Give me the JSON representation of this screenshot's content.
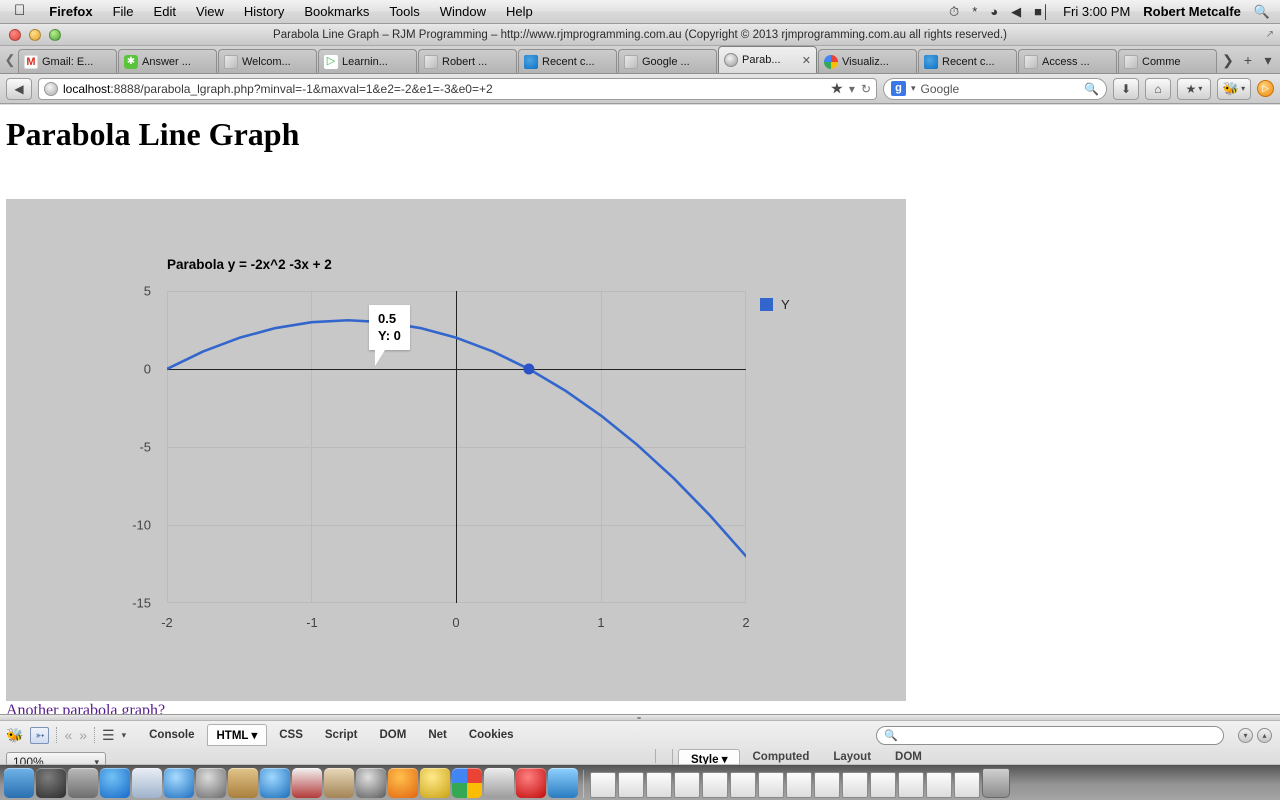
{
  "menubar": {
    "apple_icon": "apple-logo",
    "items": [
      "Firefox",
      "File",
      "Edit",
      "View",
      "History",
      "Bookmarks",
      "Tools",
      "Window",
      "Help"
    ],
    "status_icons": [
      "time-machine-icon",
      "bluetooth-icon",
      "wifi-icon",
      "volume-icon",
      "battery-icon"
    ],
    "clock": "Fri 3:00 PM",
    "user": "Robert Metcalfe",
    "search_icon": "spotlight-search-icon"
  },
  "window": {
    "title": "Parabola Line Graph – RJM Programming – http://www.rjmprogramming.com.au (Copyright © 2013 rjmprogramming.com.au all rights reserved.)"
  },
  "tabs": [
    {
      "label": "Gmail: E...",
      "favicon": "gmail-icon",
      "active": false
    },
    {
      "label": "Answer ...",
      "favicon": "green-chat-icon",
      "active": false
    },
    {
      "label": "Welcom...",
      "favicon": "generic-page-icon",
      "active": false
    },
    {
      "label": "Learnin...",
      "favicon": "play-store-icon",
      "active": false
    },
    {
      "label": "Robert ...",
      "favicon": "generic-page-icon",
      "active": false
    },
    {
      "label": "Recent c...",
      "favicon": "drupal-icon",
      "active": false
    },
    {
      "label": "Google ...",
      "favicon": "generic-page-icon",
      "active": false
    },
    {
      "label": "Parab...",
      "favicon": "globe-icon",
      "active": true,
      "close_label": "✕"
    },
    {
      "label": "Visualiz...",
      "favicon": "google-colors-icon",
      "active": false
    },
    {
      "label": "Recent c...",
      "favicon": "drupal-icon",
      "active": false
    },
    {
      "label": "Access ...",
      "favicon": "generic-page-icon",
      "active": false
    },
    {
      "label": "Comme",
      "favicon": "generic-page-icon",
      "active": false
    }
  ],
  "tabstrip": {
    "scroll_left_icon": "chevron-left-icon",
    "scroll_right_icon": "chevron-right-icon",
    "new_tab_label": "+",
    "tab_list_icon": "chevron-down-icon"
  },
  "navbar": {
    "back_icon": "back-arrow-icon",
    "url_host": "localhost",
    "url_path": ":8888/parabola_lgraph.php?minval=-1&maxval=1&e2=-2&e1=-3&e0=+2",
    "bookmark_icon": "star-icon",
    "bookmark_dropdown_icon": "chevron-down-icon",
    "reload_icon": "reload-icon",
    "search_engine": "Google",
    "search_engine_badge": "g",
    "search_icon": "magnifier-icon",
    "download_icon": "download-arrow-icon",
    "home_icon": "home-icon",
    "bookmarks_icon": "bookmarks-star-icon",
    "firebug_icon": "firebug-bee-icon",
    "addon_icon": "orange-addon-icon"
  },
  "page": {
    "heading": "Parabola Line Graph",
    "link_text": "Another parabola graph?"
  },
  "chart_data": {
    "type": "line",
    "title": "Parabola y = -2x^2 -3x + 2",
    "xlabel": "",
    "ylabel": "",
    "xlim": [
      -2,
      2
    ],
    "ylim": [
      -15,
      5
    ],
    "xticks": [
      "-2",
      "-1",
      "0",
      "1",
      "2"
    ],
    "xtick_values": [
      -2,
      -1,
      0,
      1,
      2
    ],
    "yticks": [
      "5",
      "0",
      "-5",
      "-10",
      "-15"
    ],
    "ytick_values": [
      5,
      0,
      -5,
      -10,
      -15
    ],
    "grid": true,
    "legend": [
      "Y"
    ],
    "legend_position": "right",
    "series": [
      {
        "name": "Y",
        "color": "#3366cc",
        "equation": "y = -2x^2 - 3x + 2",
        "x": [
          -2,
          -1.75,
          -1.5,
          -1.25,
          -1,
          -0.75,
          -0.5,
          -0.25,
          0,
          0.25,
          0.5,
          0.75,
          1,
          1.25,
          1.5,
          1.75,
          2
        ],
        "y": [
          0,
          1.125,
          2,
          2.625,
          3,
          3.125,
          3,
          2.625,
          2,
          1.125,
          0,
          -1.375,
          -3,
          -4.875,
          -7,
          -9.375,
          -12
        ]
      }
    ],
    "tooltip": {
      "x_label": "0.5",
      "y_label": "Y: 0",
      "point_x": 0.5,
      "point_y": 0
    }
  },
  "firebug": {
    "bee_icon": "firebug-bee-icon",
    "inspect_icon": "inspect-cursor-icon",
    "nav_back_icon": "double-chevron-left-icon",
    "nav_forward_icon": "double-chevron-right-icon",
    "menu_icon": "hamburger-menu-icon",
    "options_icon": "chevron-down-icon",
    "tabs": [
      "Console",
      "HTML",
      "CSS",
      "Script",
      "DOM",
      "Net",
      "Cookies"
    ],
    "active_tab": "HTML",
    "active_tab_dropdown": "▾",
    "search_icon": "magnifier-icon",
    "search_placeholder": "",
    "minimize_icon": "chevron-down-circle-icon",
    "maximize_icon": "chevron-up-circle-icon",
    "subtabs": [
      "Style",
      "Computed",
      "Layout",
      "DOM"
    ],
    "active_subtab": "Style",
    "active_subtab_dropdown": "▾"
  },
  "statusbar": {
    "zoom_level": "100%",
    "zoom_dropdown_icon": "chevron-down-icon"
  },
  "dock": {
    "icons": [
      {
        "name": "finder",
        "color": "linear-gradient(to bottom, #6fb3e8, #2a6fb0)"
      },
      {
        "name": "dashboard",
        "color": "radial-gradient(circle at 40% 30%, #7d7d7d, #2b2b2b)"
      },
      {
        "name": "system-preferences",
        "color": "linear-gradient(to bottom, #b9b9b9, #6e6e6e)"
      },
      {
        "name": "app-store",
        "color": "radial-gradient(circle at 40% 30%, #72c2f5, #1669c9)"
      },
      {
        "name": "preview",
        "color": "linear-gradient(to bottom, #e8eef6, #9fb3cc)"
      },
      {
        "name": "safari",
        "color": "radial-gradient(circle at 40% 30%, #a8dcff, #1d6fc0)"
      },
      {
        "name": "facetime",
        "color": "radial-gradient(circle at 40% 30%, #dcdcdc, #6a6a6a)"
      },
      {
        "name": "contacts",
        "color": "linear-gradient(to bottom, #e2c48a, #a97f3d)"
      },
      {
        "name": "itunes",
        "color": "radial-gradient(circle at 40% 30%, #9fd8ff, #1a6dbb)"
      },
      {
        "name": "textedit",
        "color": "linear-gradient(to bottom, #f2f2f2, #b33b3b)"
      },
      {
        "name": "iphoto",
        "color": "linear-gradient(to bottom, #e8d8b8, #a38456)"
      },
      {
        "name": "camera",
        "color": "radial-gradient(circle at 40% 30%, #e0e0e0, #5a5a5a)"
      },
      {
        "name": "firefox",
        "color": "radial-gradient(circle at 40% 30%, #ffc04d, #e1650f)"
      },
      {
        "name": "mamp",
        "color": "radial-gradient(circle at 40% 30%, #ffe98a, #c9a112)"
      },
      {
        "name": "chrome",
        "color": "conic-gradient(#ea4335 0 25%, #fbbc05 0 50%, #34a853 0 75%, #4285f4 0)"
      },
      {
        "name": "xcode",
        "color": "linear-gradient(to bottom, #ececec, #9c9c9c)"
      },
      {
        "name": "opera",
        "color": "radial-gradient(circle at 40% 30%, #ff8080, #c00a0a)"
      },
      {
        "name": "notes",
        "color": "linear-gradient(to bottom, #8fd0ff, #2a7cc0)"
      }
    ],
    "minimized_count": 14,
    "trash_icon": "trash-icon"
  }
}
